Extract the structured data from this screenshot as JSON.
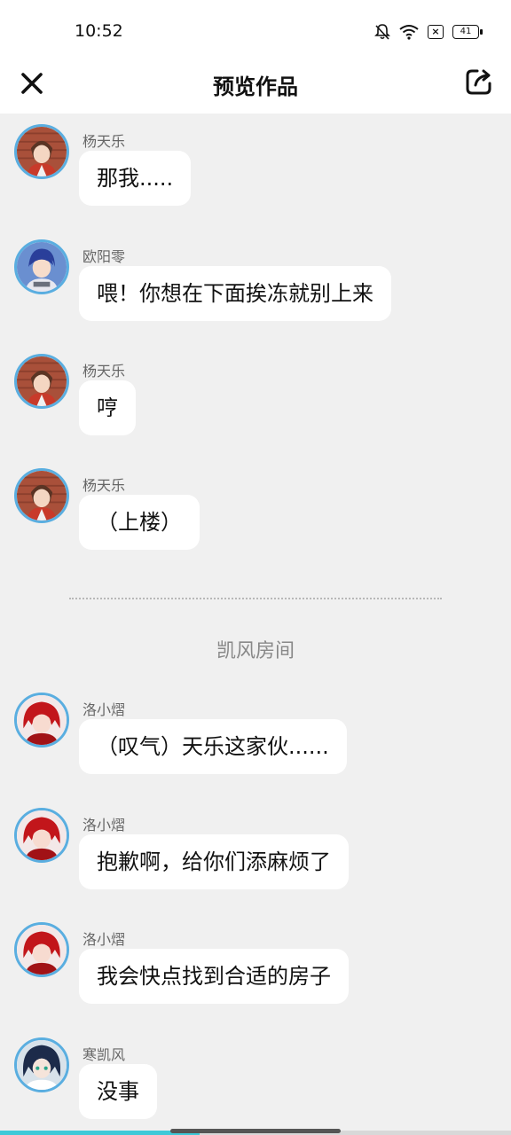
{
  "status_bar": {
    "time": "10:52",
    "battery": "41",
    "icons": [
      "bell-off-icon",
      "wifi-icon",
      "sim-x-icon",
      "battery-icon"
    ]
  },
  "header": {
    "title": "预览作品",
    "left_icon": "close-icon",
    "right_icon": "share-icon"
  },
  "messages_before": [
    {
      "speaker": "杨天乐",
      "text": "那我.....",
      "avatar": "yang-tianle"
    },
    {
      "speaker": "欧阳零",
      "text": "喂！你想在下面挨冻就别上来",
      "avatar": "ouyang-ling"
    },
    {
      "speaker": "杨天乐",
      "text": "哼",
      "avatar": "yang-tianle"
    },
    {
      "speaker": "杨天乐",
      "text": "（上楼）",
      "avatar": "yang-tianle"
    }
  ],
  "scene_title": "凯风房间",
  "messages_after": [
    {
      "speaker": "洛小熠",
      "text": "（叹气）天乐这家伙......",
      "avatar": "luo-xiaoyi"
    },
    {
      "speaker": "洛小熠",
      "text": "抱歉啊，给你们添麻烦了",
      "avatar": "luo-xiaoyi"
    },
    {
      "speaker": "洛小熠",
      "text": "我会快点找到合适的房子",
      "avatar": "luo-xiaoyi"
    },
    {
      "speaker": "寒凯风",
      "text": "没事",
      "avatar": "han-kaifeng"
    }
  ],
  "progress": 0.39,
  "colors": {
    "accent": "#3ec9d8",
    "avatar_ring": "#5aaee0",
    "background": "#f0f0f0"
  }
}
